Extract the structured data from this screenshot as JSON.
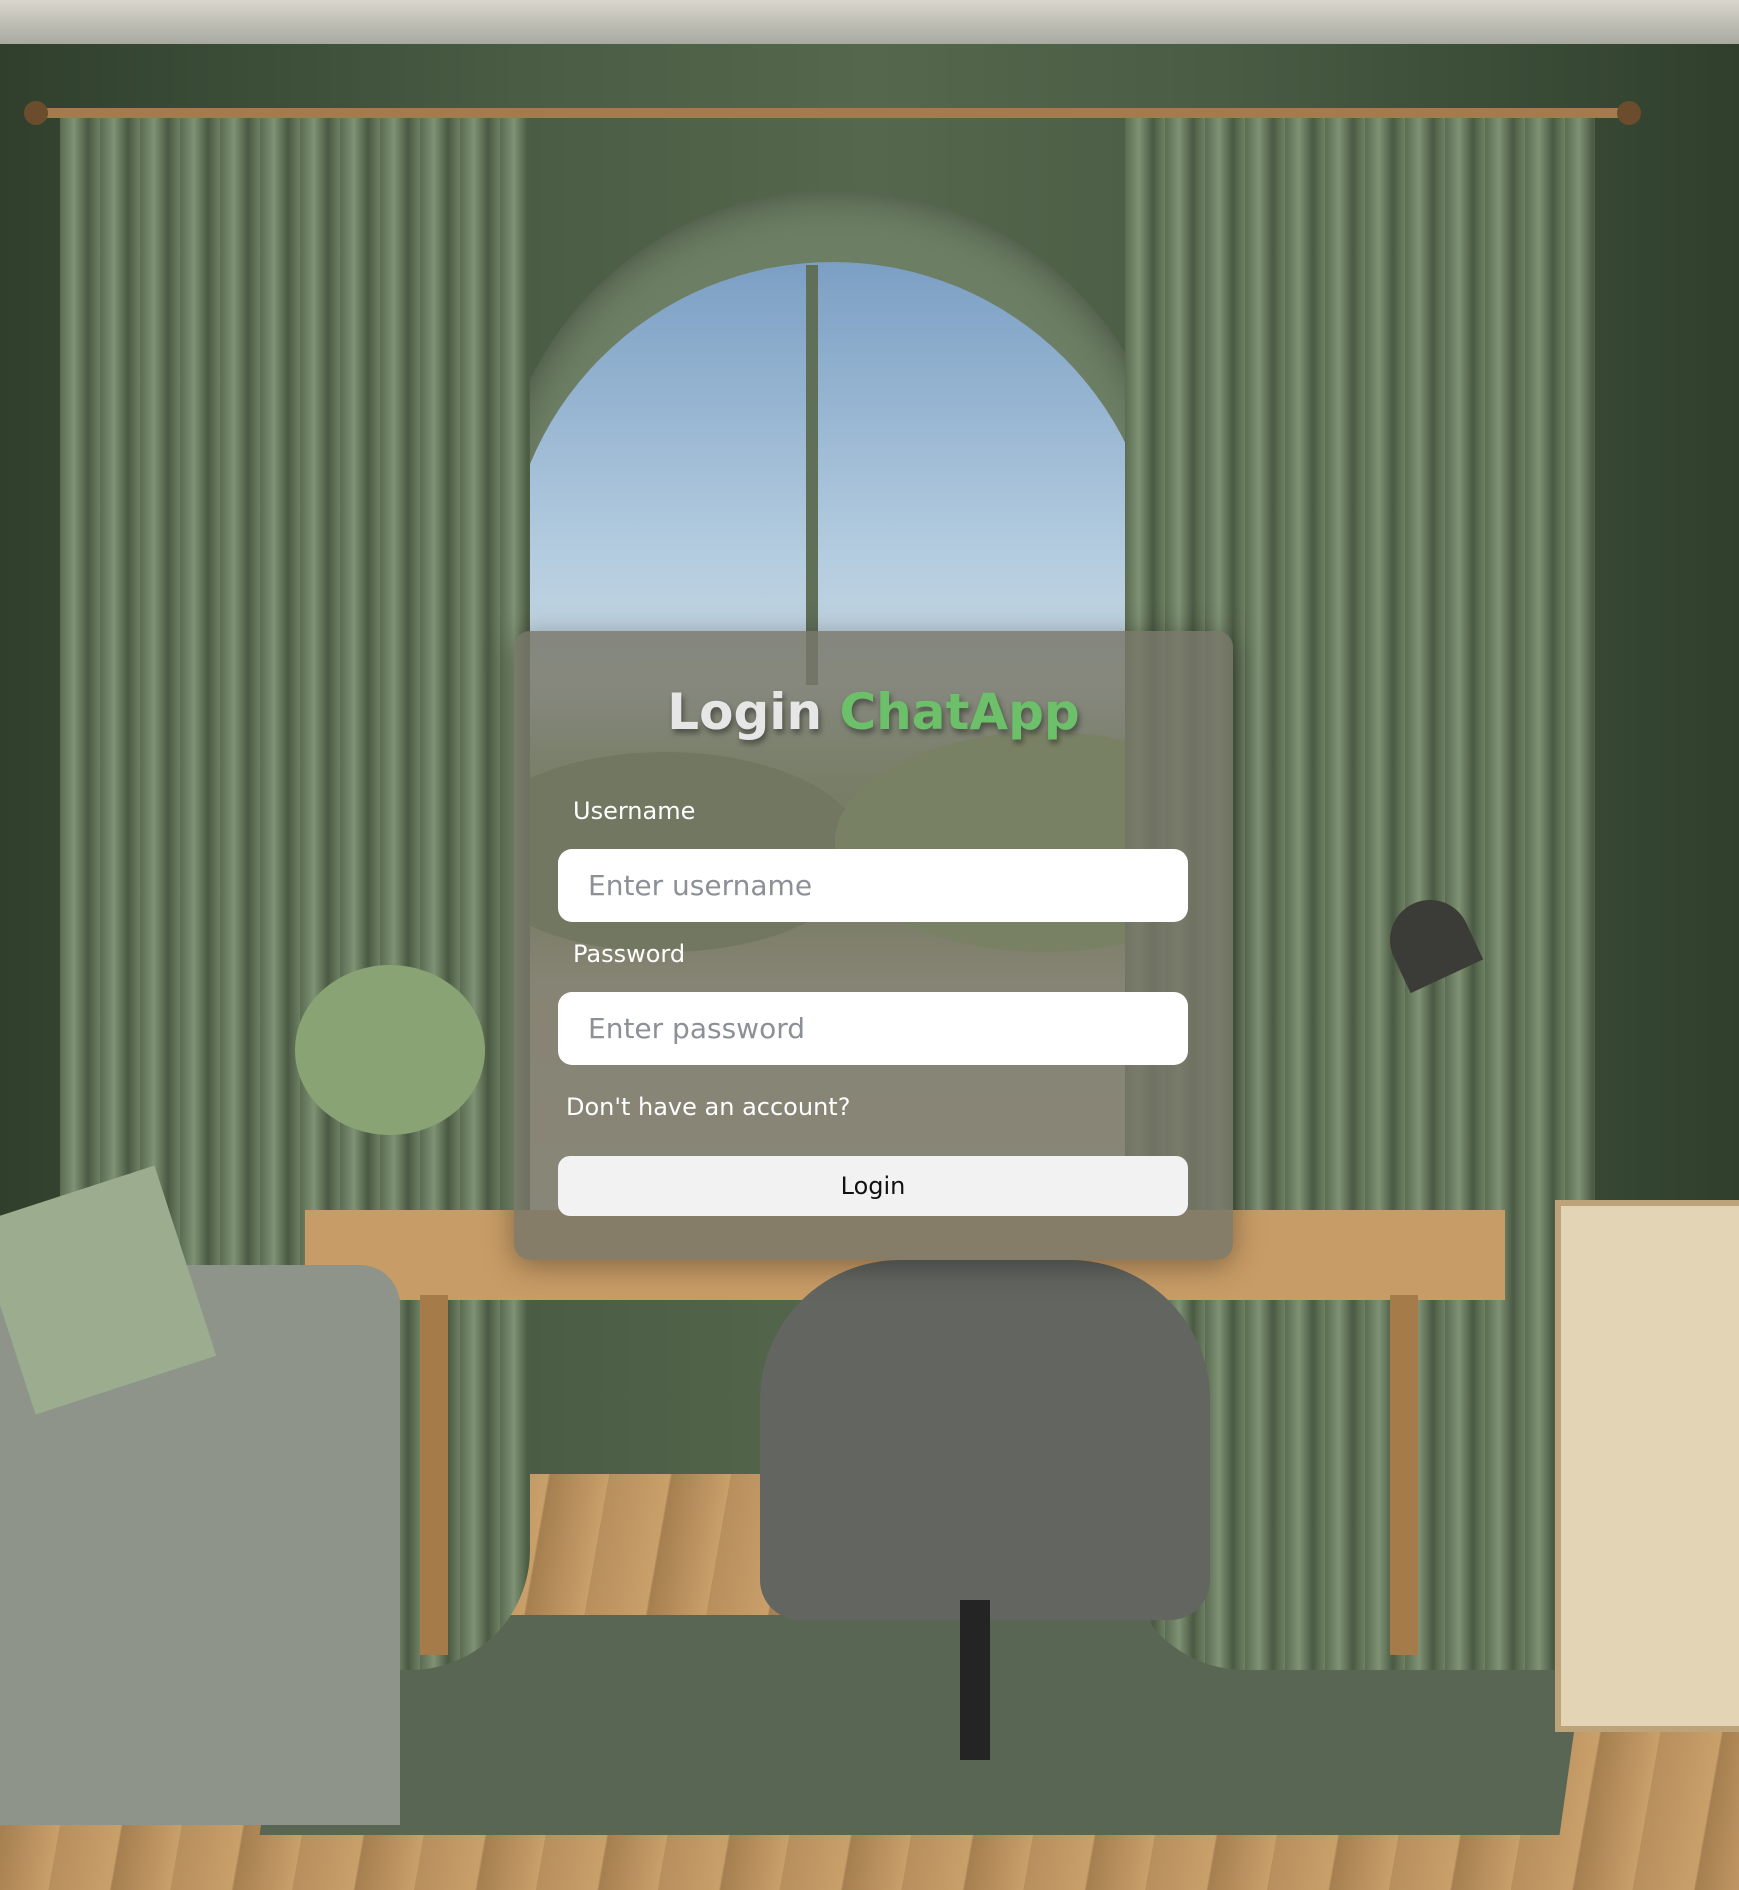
{
  "login": {
    "title_prefix": "Login",
    "title_brand": "ChatApp",
    "username": {
      "label": "Username",
      "placeholder": "Enter username",
      "value": ""
    },
    "password": {
      "label": "Password",
      "placeholder": "Enter password",
      "value": ""
    },
    "signup_link": "Don't have an account?",
    "submit_label": "Login"
  },
  "colors": {
    "brand": "#6cc06a",
    "card": "rgba(120,118,105,0.82)",
    "button": "#f2f2f2"
  }
}
